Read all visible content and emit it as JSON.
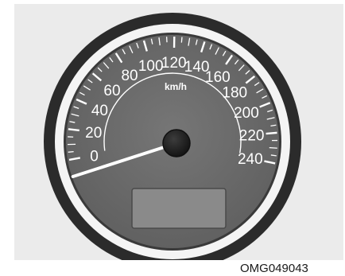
{
  "gauge": {
    "unit_label": "km/h",
    "min": 0,
    "max": 240,
    "major_step": 20,
    "minor_step": 5,
    "needle_value": 0,
    "scale_labels": [
      "0",
      "20",
      "40",
      "60",
      "80",
      "100",
      "120",
      "140",
      "160",
      "180",
      "200",
      "220",
      "240"
    ]
  },
  "caption": {
    "code": "OMG049043"
  },
  "colors": {
    "background": "#ebebeb",
    "bezel_outer": "#2b2b2b",
    "bezel_inner": "#f4f4f4",
    "dial_face": "#6b6b6b",
    "markings": "#ffffff",
    "hub": "#1e1e1e",
    "display": "#8a8a8a"
  },
  "icons": {
    "needle": "speedometer-needle"
  }
}
